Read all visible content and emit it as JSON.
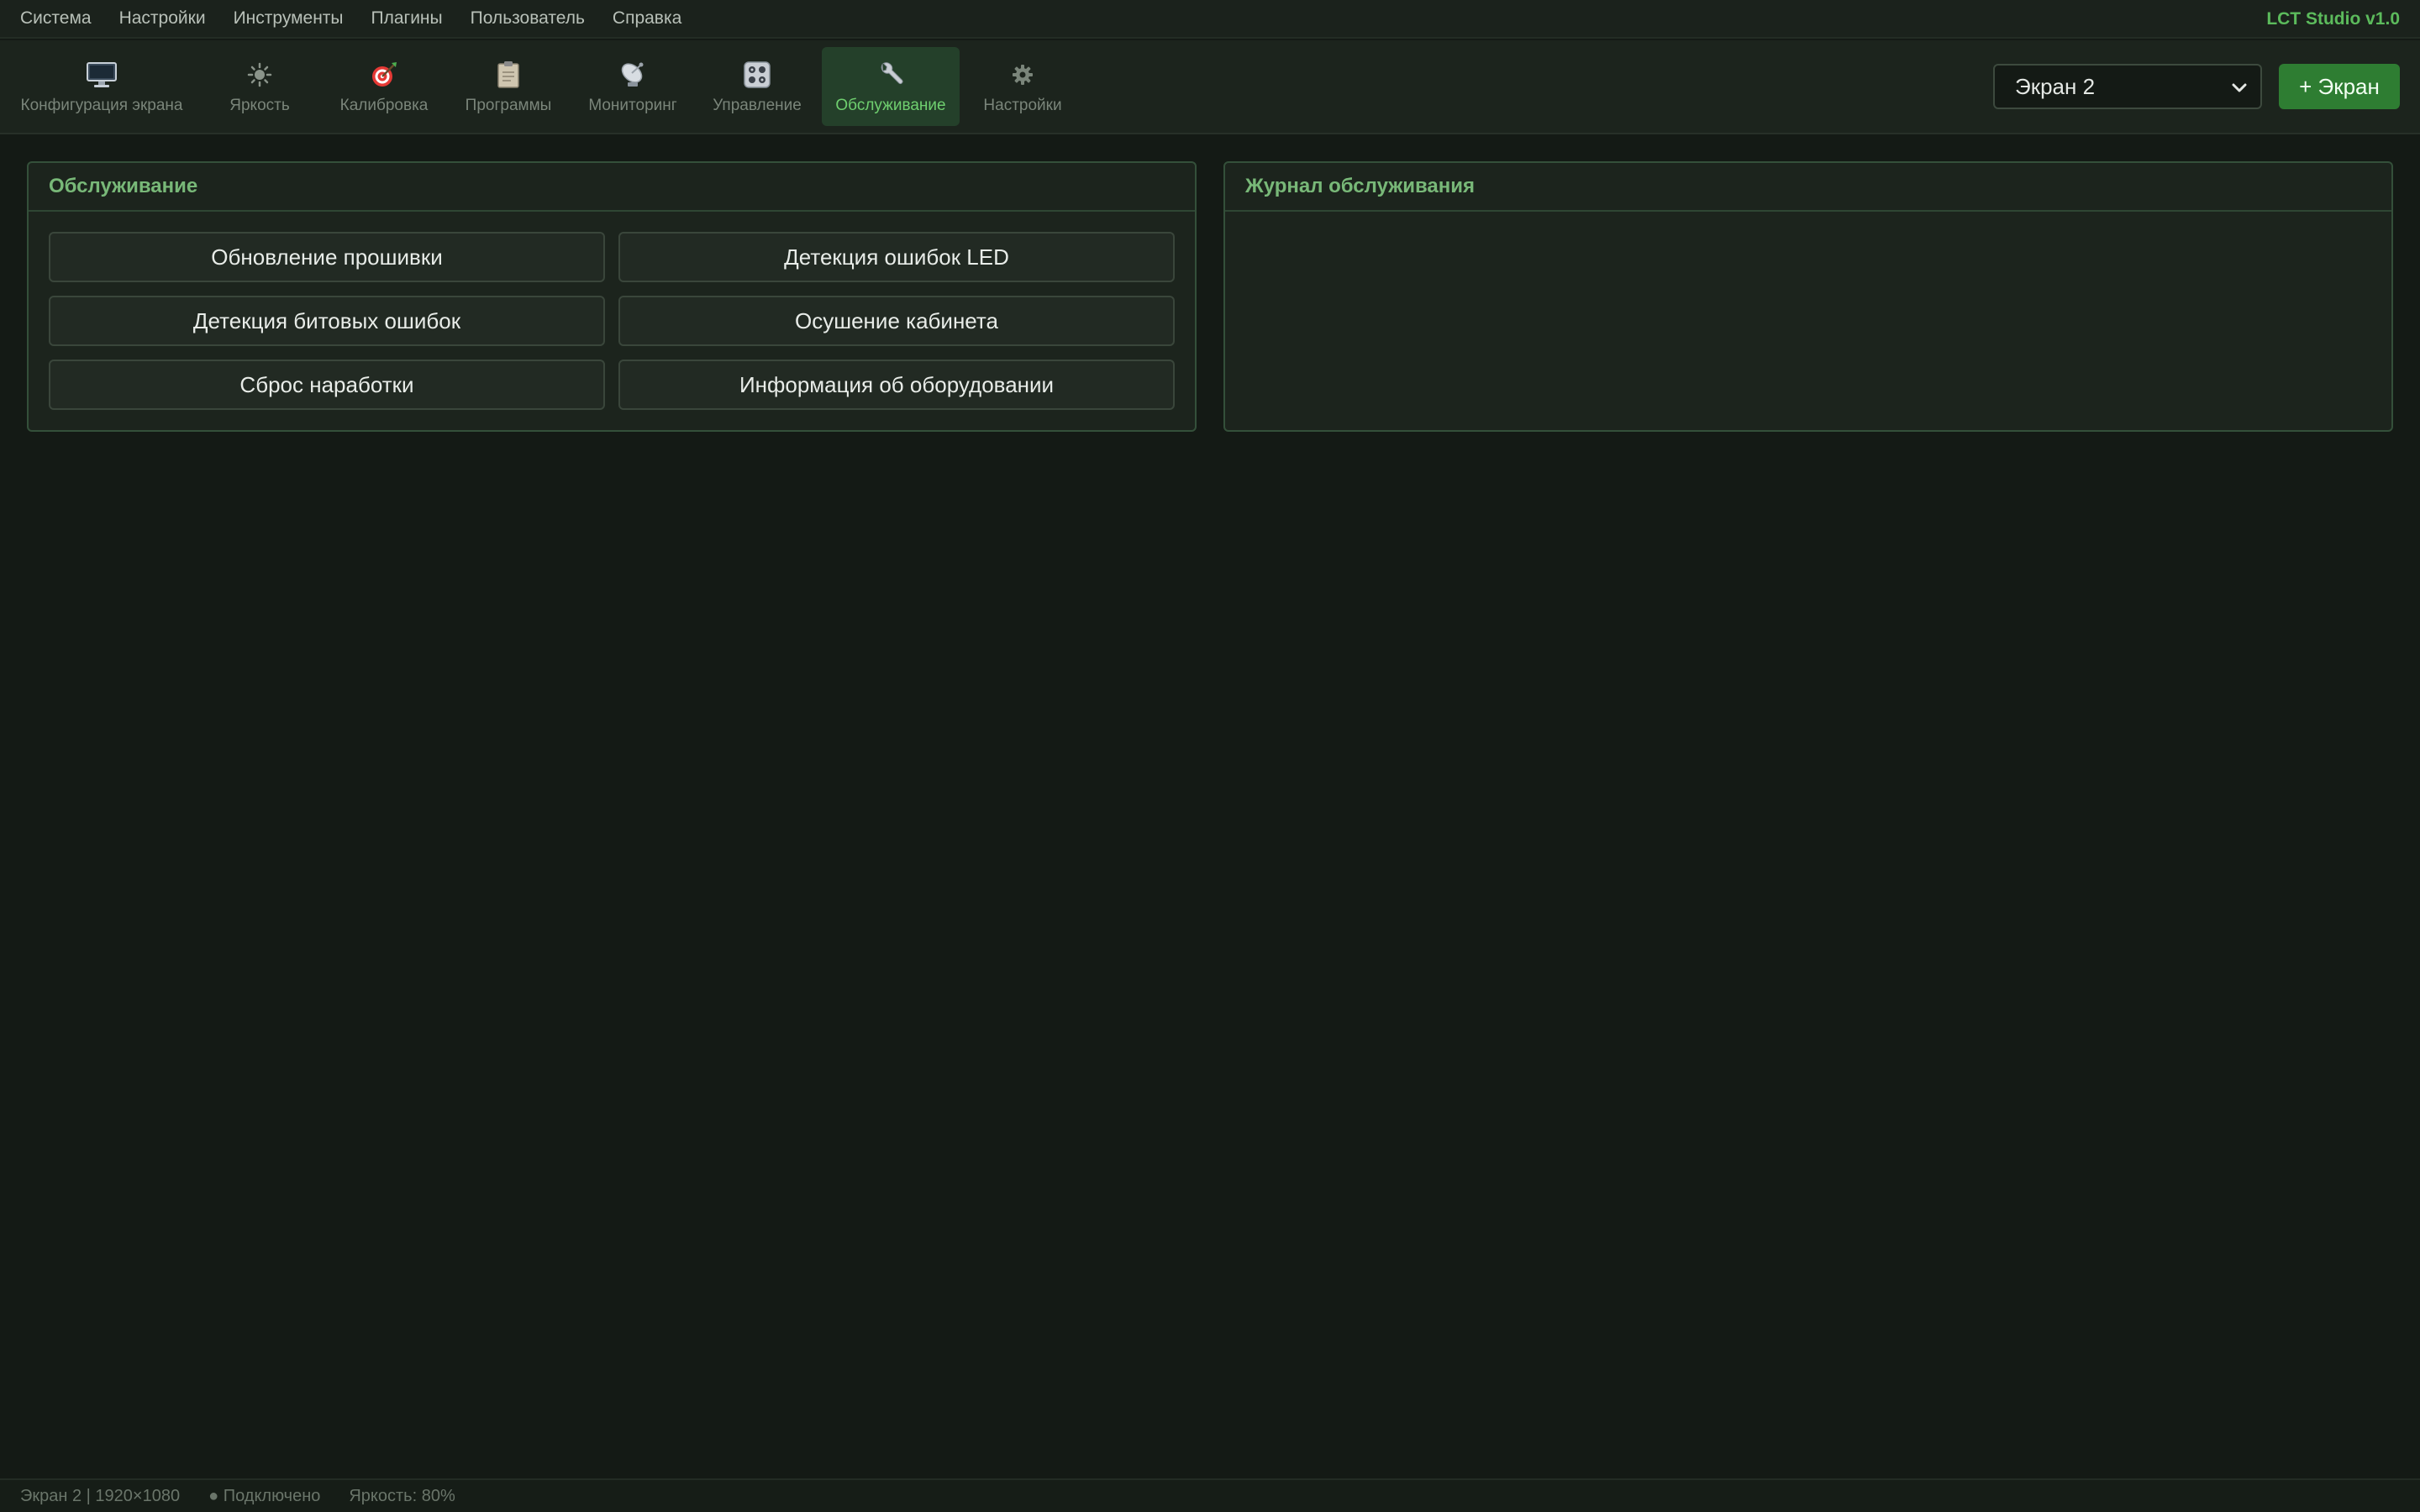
{
  "menu": {
    "items": [
      "Система",
      "Настройки",
      "Инструменты",
      "Плагины",
      "Пользователь",
      "Справка"
    ],
    "app_title": "LCT Studio v1.0"
  },
  "toolbar": {
    "tools": [
      {
        "label": "Конфигурация экрана",
        "icon": "monitor-icon"
      },
      {
        "label": "Яркость",
        "icon": "sun-icon"
      },
      {
        "label": "Калибровка",
        "icon": "target-icon"
      },
      {
        "label": "Программы",
        "icon": "clipboard-icon"
      },
      {
        "label": "Мониторинг",
        "icon": "satellite-icon"
      },
      {
        "label": "Управление",
        "icon": "control-panel-icon"
      },
      {
        "label": "Обслуживание",
        "icon": "wrench-icon",
        "active": true
      },
      {
        "label": "Настройки",
        "icon": "gear-icon"
      }
    ],
    "screen_select": {
      "value": "Экран 2"
    },
    "add_screen_label": "+ Экран"
  },
  "maintenance": {
    "title": "Обслуживание",
    "buttons": [
      "Обновление прошивки",
      "Детекция ошибок LED",
      "Детекция битовых ошибок",
      "Осушение кабинета",
      "Сброс наработки",
      "Информация об оборудовании"
    ]
  },
  "log": {
    "title": "Журнал обслуживания"
  },
  "status": {
    "screen": "Экран 2 | 1920×1080",
    "connection": "● Подключено",
    "brightness": "Яркость: 80%"
  },
  "colors": {
    "accent": "#5cbb5c",
    "add_button": "#2e7d32",
    "active_tab": "#24402a",
    "background": "#141a15"
  }
}
